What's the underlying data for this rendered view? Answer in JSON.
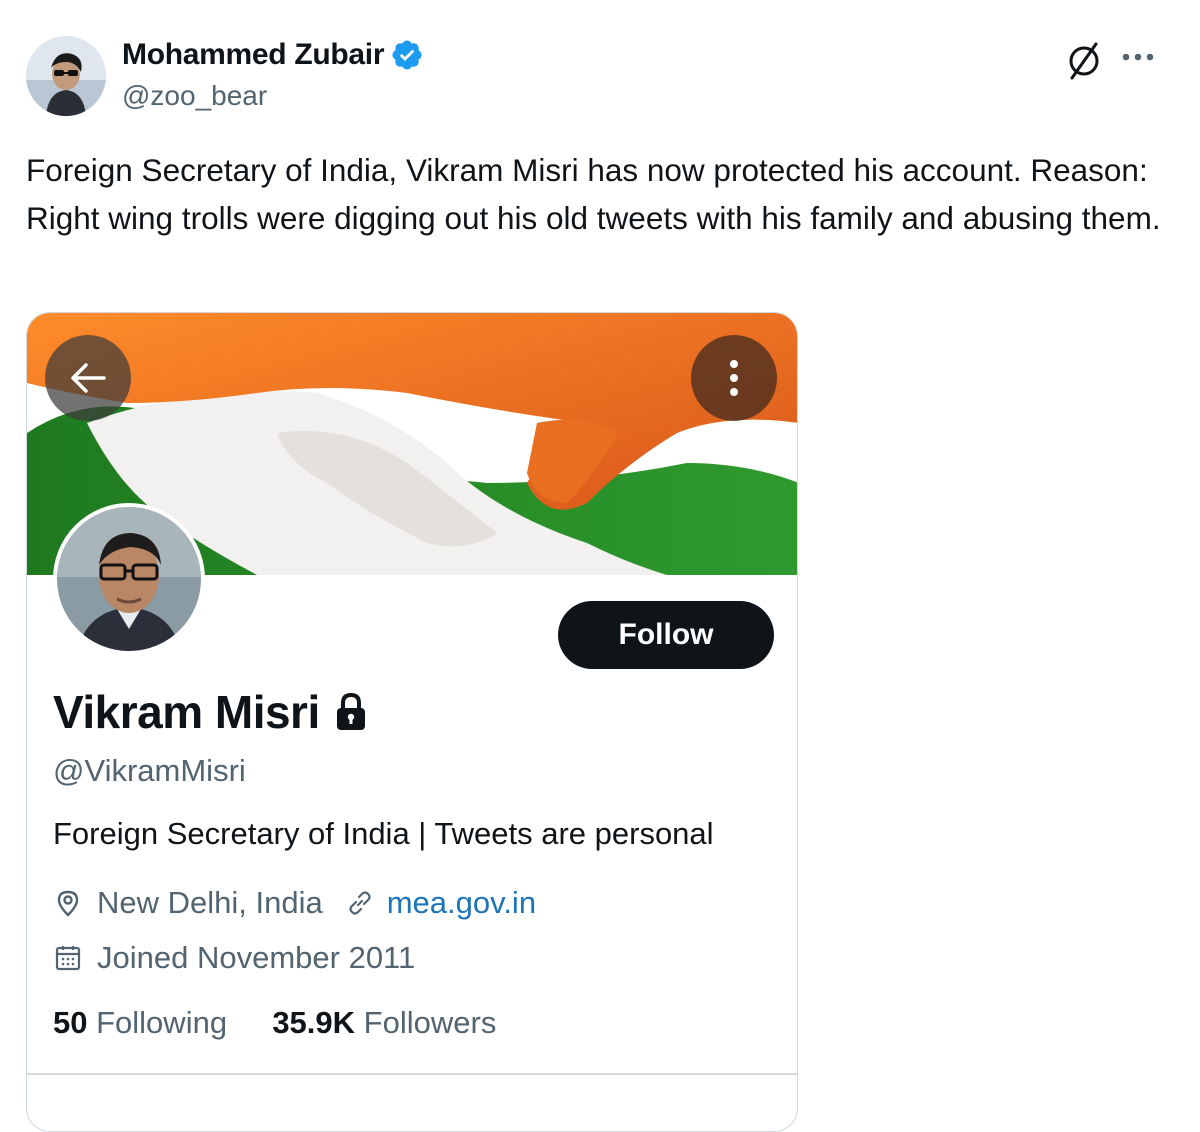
{
  "author": {
    "name": "Mohammed Zubair",
    "handle": "@zoo_bear",
    "verified": true
  },
  "tweet": {
    "text": "Foreign Secretary of India, Vikram Misri has now protected his account. Reason: Right wing trolls were digging out his old tweets with his family and abusing them."
  },
  "icons": {
    "verified": "verified-badge-icon",
    "grok": "slashed-circle-icon",
    "more": "more-dots-icon",
    "back": "arrow-left-icon",
    "kebab": "vertical-dots-icon",
    "lock": "lock-icon",
    "location": "location-pin-icon",
    "link": "link-icon",
    "calendar": "calendar-icon"
  },
  "profile_card": {
    "name": "Vikram Misri",
    "protected": true,
    "handle": "@VikramMisri",
    "bio": "Foreign Secretary of India | Tweets are personal",
    "location": "New Delhi, India",
    "website": "mea.gov.in",
    "joined": "Joined November 2011",
    "follow_label": "Follow",
    "following_count": "50",
    "following_label": "Following",
    "followers_count": "35.9K",
    "followers_label": "Followers"
  },
  "colors": {
    "text": "#0f1419",
    "secondary": "#536471",
    "link": "#1d74b8",
    "verified": "#1d9bf0",
    "border": "#cfd9de"
  }
}
